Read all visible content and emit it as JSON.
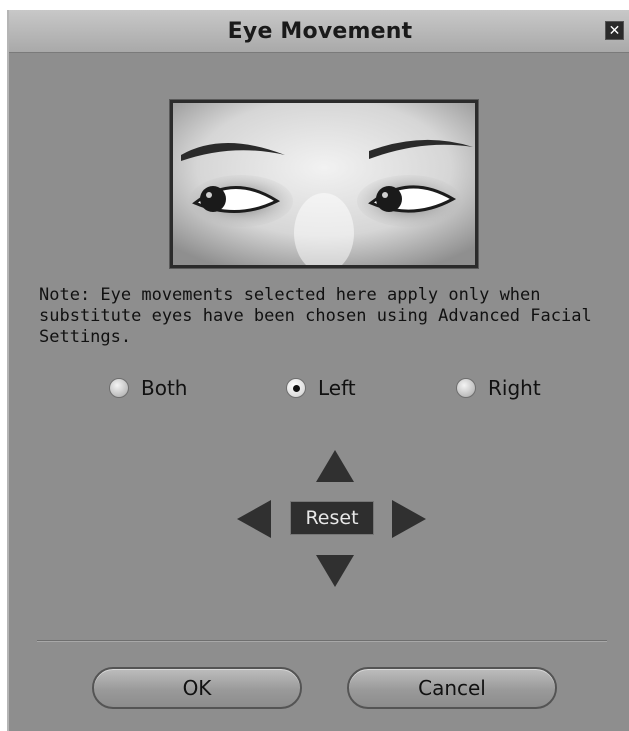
{
  "window": {
    "title": "Eye Movement",
    "close_glyph": "✕"
  },
  "preview": {
    "description_icon": "eyes-preview-image"
  },
  "note": "Note: Eye movements selected here apply only when substitute eyes have been chosen using Advanced Facial Settings.",
  "eye_selection": {
    "options": [
      {
        "label": "Both",
        "checked": false
      },
      {
        "label": "Left",
        "checked": true
      },
      {
        "label": "Right",
        "checked": false
      }
    ]
  },
  "direction_pad": {
    "reset_label": "Reset"
  },
  "buttons": {
    "ok_label": "OK",
    "cancel_label": "Cancel"
  },
  "colors": {
    "dialog_bg": "#8e8e8e",
    "titlebar_bg": "#b8b8b8",
    "arrow": "#303030"
  }
}
